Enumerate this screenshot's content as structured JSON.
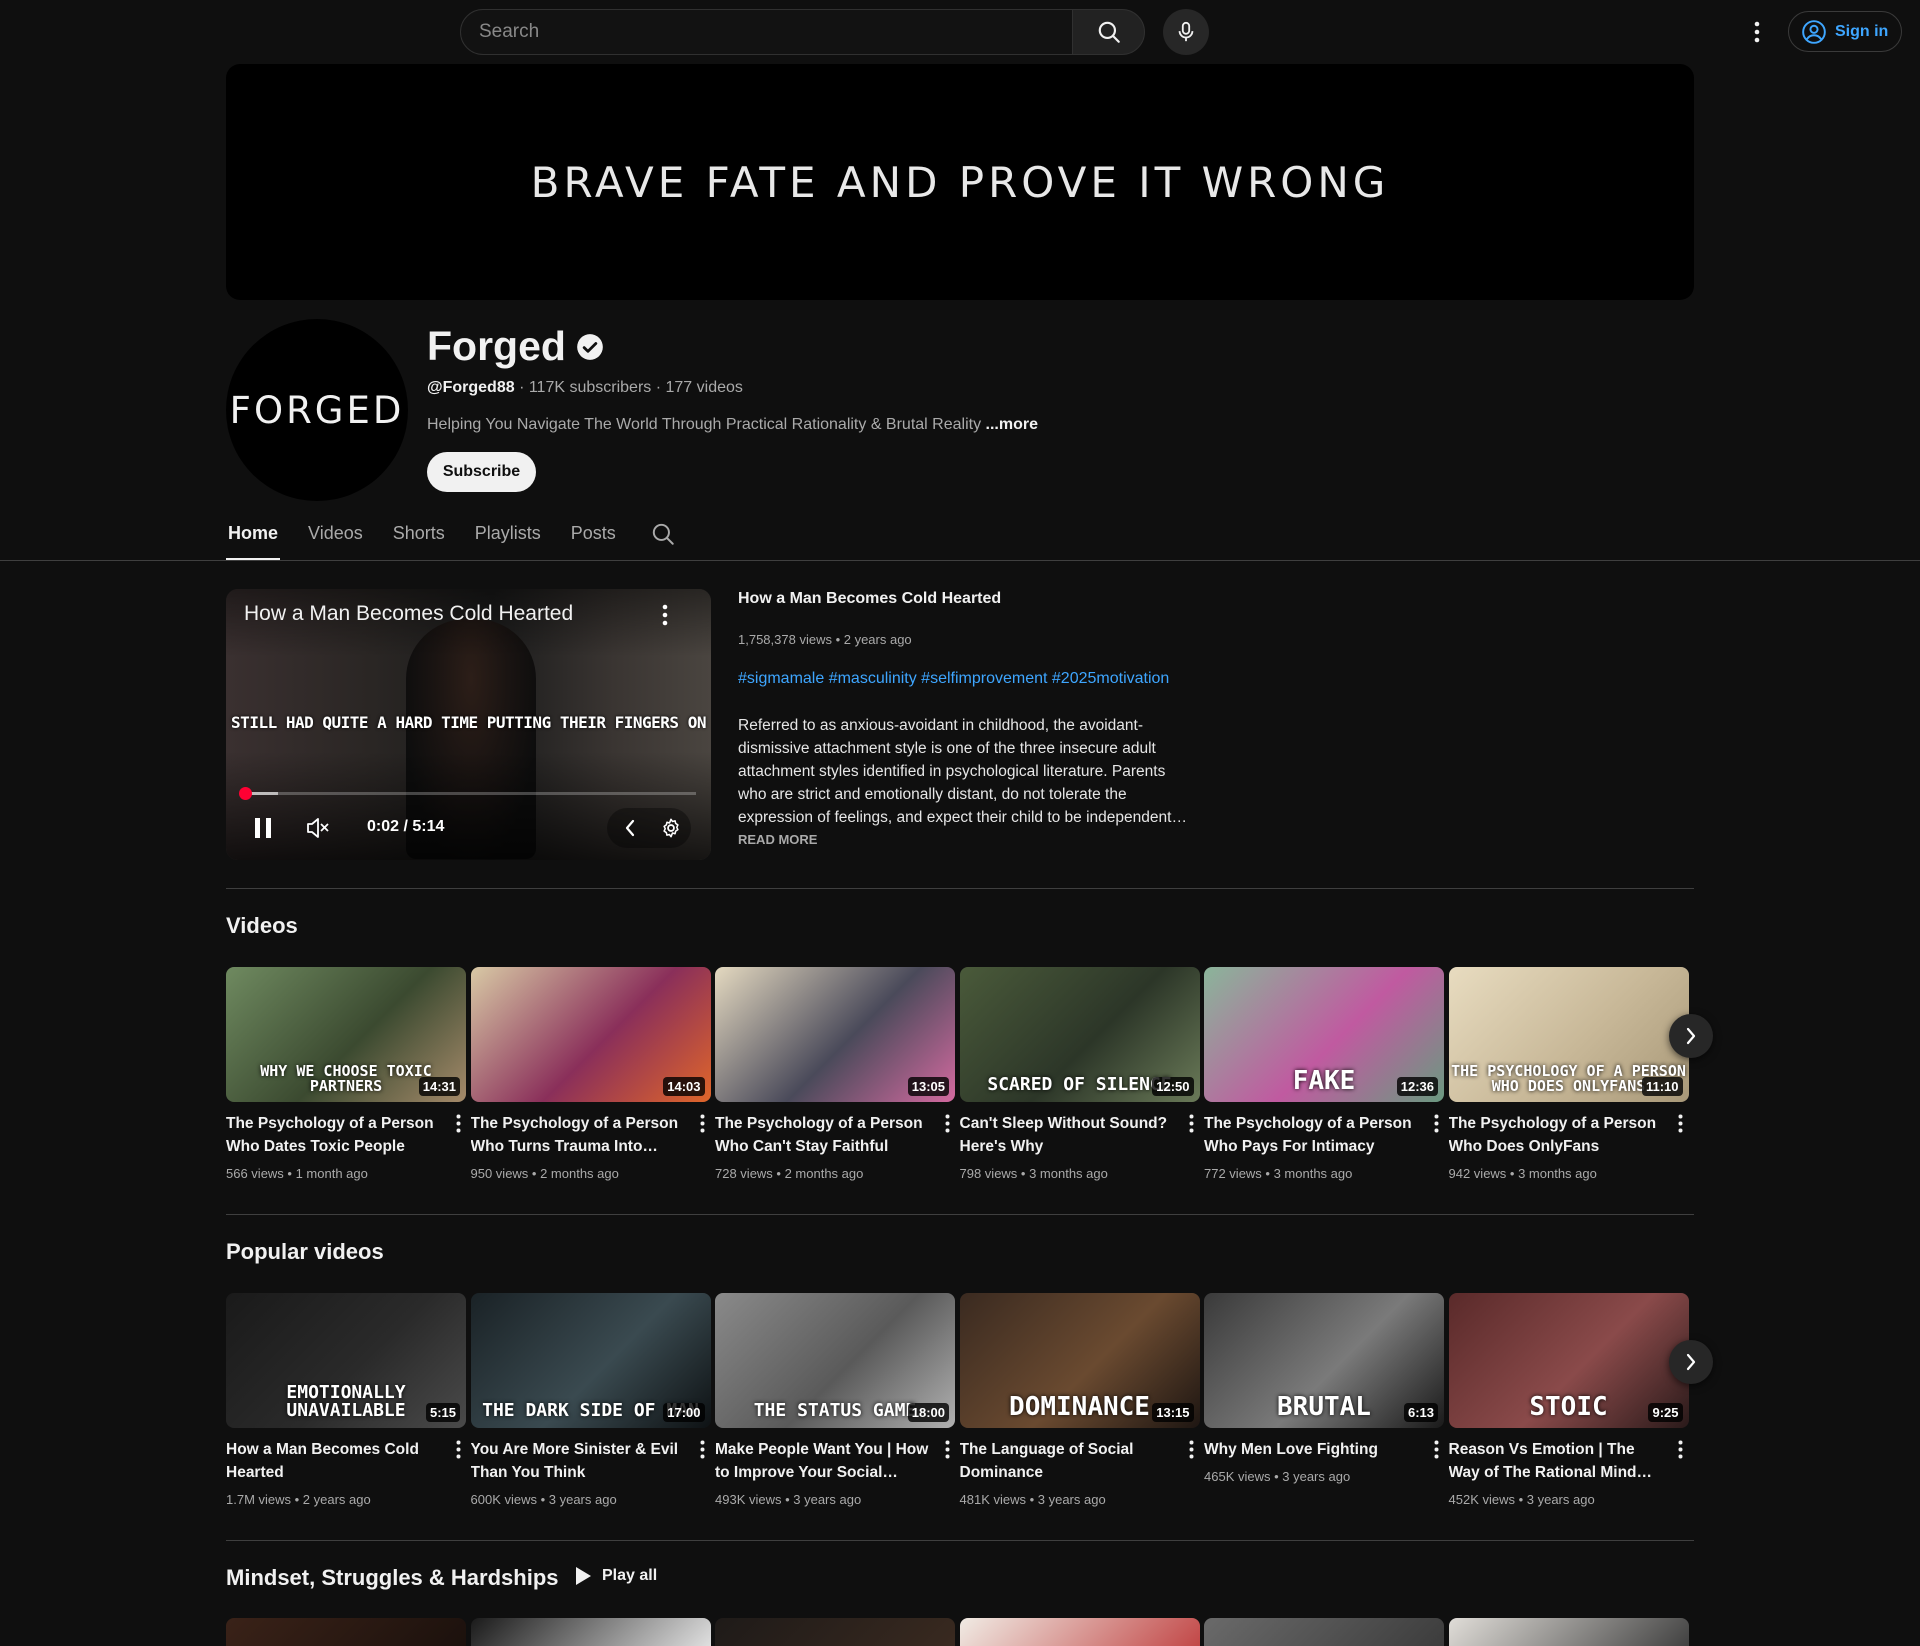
{
  "search": {
    "placeholder": "Search"
  },
  "header": {
    "signin_label": "Sign in"
  },
  "banner": {
    "text": "BRAVE FATE AND PROVE IT WRONG"
  },
  "channel": {
    "avatar_text": "FORGED",
    "name": "Forged",
    "handle": "@Forged88",
    "stats": " · 117K subscribers · 177 videos",
    "description": "Helping You Navigate The World Through Practical Rationality & Brutal Reality ",
    "more_label": "...more",
    "subscribe_label": "Subscribe"
  },
  "tabs": [
    {
      "label": "Home",
      "active": true
    },
    {
      "label": "Videos"
    },
    {
      "label": "Shorts"
    },
    {
      "label": "Playlists"
    },
    {
      "label": "Posts"
    }
  ],
  "featured": {
    "player_title": "How a Man Becomes Cold Hearted",
    "caption": "STILL HAD QUITE A HARD TIME PUTTING THEIR FINGERS ON",
    "time": "0:02 / 5:14",
    "progress_fraction": 0.0064,
    "buffered_fraction": 0.08,
    "title": "How a Man Becomes Cold Hearted",
    "meta": "1,758,378 views • 2 years ago",
    "tags": "#sigmamale #masculinity #selfimprovement #2025motivation",
    "description": "Referred to as anxious-avoidant in childhood, the avoidant-dismissive attachment style is one of the three insecure adult attachment styles identified in psychological literature. Parents who are strict and emotionally distant, do not tolerate the expression of feelings, and expect their child to be independent and tough.",
    "read_more": "READ MORE"
  },
  "sections": {
    "videos_title": "Videos",
    "popular_title": "Popular videos",
    "playlist_title": "Mindset, Struggles & Hardships",
    "play_all_label": "Play all"
  },
  "videos": [
    {
      "title": "The Psychology of a Person Who Dates Toxic People",
      "meta": "566 views • 1 month ago",
      "duration": "14:31",
      "thumb_text": "WHY WE CHOOSE TOXIC PARTNERS",
      "colors": [
        "#6f8a60",
        "#3b4a30",
        "#a58a6a"
      ]
    },
    {
      "title": "The Psychology of a Person Who Turns Trauma Into…",
      "meta": "950 views • 2 months ago",
      "duration": "14:03",
      "thumb_text": "",
      "colors": [
        "#d8c9a5",
        "#8a2f5a",
        "#e0662a"
      ]
    },
    {
      "title": "The Psychology of a Person Who Can't Stay Faithful",
      "meta": "728 views • 2 months ago",
      "duration": "13:05",
      "thumb_text": "",
      "colors": [
        "#e4d9c0",
        "#4a4a5a",
        "#d46aa0"
      ]
    },
    {
      "title": "Can't Sleep Without Sound? Here's Why",
      "meta": "798 views • 3 months ago",
      "duration": "12:50",
      "thumb_text": "SCARED OF SILENCE",
      "colors": [
        "#4a5a3a",
        "#2c3628",
        "#6a7a58"
      ]
    },
    {
      "title": "The Psychology of a Person Who Pays For Intimacy",
      "meta": "772 views • 3 months ago",
      "duration": "12:36",
      "thumb_text": "FAKE",
      "colors": [
        "#8ab59a",
        "#c05aa0",
        "#6a9a80"
      ]
    },
    {
      "title": "The Psychology of a Person Who Does OnlyFans",
      "meta": "942 views • 3 months ago",
      "duration": "11:10",
      "thumb_text": "THE PSYCHOLOGY OF A PERSON WHO DOES ONLYFANS",
      "colors": [
        "#e8dcc0",
        "#c8b898",
        "#a89878"
      ]
    }
  ],
  "popular": [
    {
      "title": "How a Man Becomes Cold Hearted",
      "meta": "1.7M views • 2 years ago",
      "duration": "5:15",
      "thumb_text": "EMOTIONALLY UNAVAILABLE",
      "colors": [
        "#1a1a1a",
        "#2a2a2a",
        "#4a4a4a"
      ]
    },
    {
      "title": "You Are More Sinister & Evil Than You Think",
      "meta": "600K views • 3 years ago",
      "duration": "17:00",
      "thumb_text": "THE DARK SIDE OF MAN",
      "colors": [
        "#1a2226",
        "#3a4a50",
        "#0e1214"
      ]
    },
    {
      "title": "Make People Want You | How to Improve Your Social Stat…",
      "meta": "493K views • 3 years ago",
      "duration": "18:00",
      "thumb_text": "THE STATUS GAME",
      "colors": [
        "#8a8a8a",
        "#5a5a5a",
        "#b0b0b0"
      ]
    },
    {
      "title": "The Language of Social Dominance",
      "meta": "481K views • 3 years ago",
      "duration": "13:15",
      "thumb_text": "DOMINANCE",
      "colors": [
        "#3a2a20",
        "#6a4a30",
        "#1e1612"
      ]
    },
    {
      "title": "Why Men Love Fighting",
      "meta": "465K views • 3 years ago",
      "duration": "6:13",
      "thumb_text": "BRUTAL",
      "colors": [
        "#3a3a3a",
        "#7a7a7a",
        "#1a1a1a"
      ]
    },
    {
      "title": "Reason Vs Emotion | The Way of The Rational Mind…",
      "meta": "452K views • 3 years ago",
      "duration": "9:25",
      "thumb_text": "STOIC",
      "colors": [
        "#5a2a2a",
        "#8a4a4a",
        "#2a1a1a"
      ]
    }
  ],
  "playlist_peek": [
    {
      "colors": [
        "#3a2218",
        "#1a100c"
      ]
    },
    {
      "colors": [
        "#1a1a1a",
        "#e8e8e8"
      ]
    },
    {
      "colors": [
        "#1e1a18",
        "#3a2a20"
      ]
    },
    {
      "colors": [
        "#f0ebe4",
        "#c04040"
      ]
    },
    {
      "colors": [
        "#6a6a6a",
        "#3a3a3a"
      ]
    },
    {
      "colors": [
        "#e0ddd8",
        "#3a3a3a"
      ]
    }
  ]
}
